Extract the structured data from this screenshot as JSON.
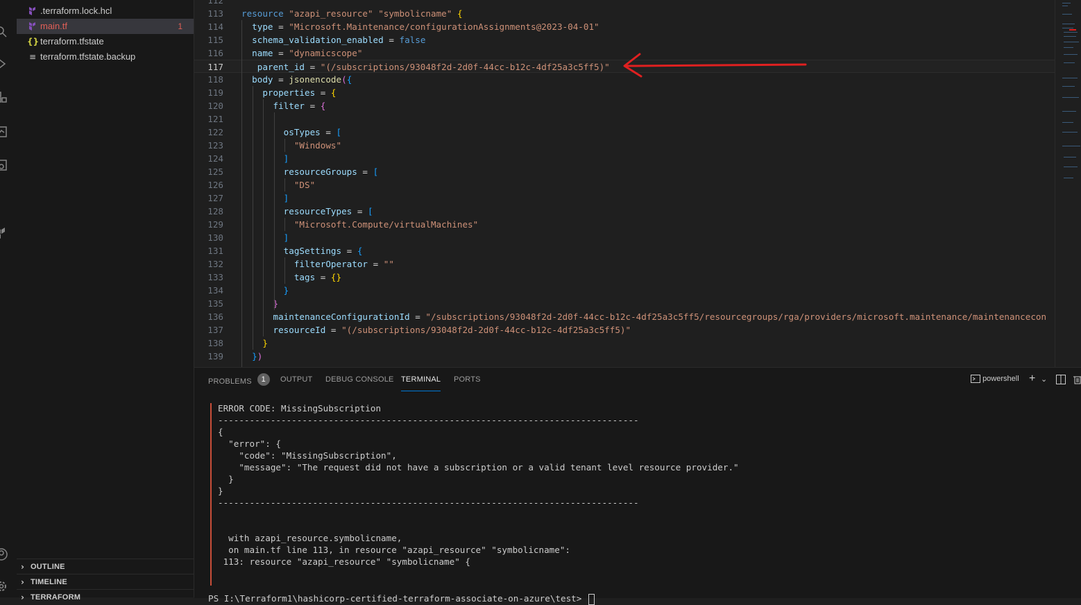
{
  "explorer": {
    "files": [
      {
        "name": ".terraform.lock.hcl",
        "icon": "terraform-icon",
        "active": false
      },
      {
        "name": "main.tf",
        "icon": "terraform-icon",
        "active": true,
        "problems": "1"
      },
      {
        "name": "terraform.tfstate",
        "icon": "json-braces-icon",
        "active": false
      },
      {
        "name": "terraform.tfstate.backup",
        "icon": "text-lines-icon",
        "active": false
      }
    ],
    "sections": [
      {
        "label": "OUTLINE",
        "collapsed": true
      },
      {
        "label": "TIMELINE",
        "collapsed": true
      },
      {
        "label": "TERRAFORM",
        "collapsed": true
      }
    ]
  },
  "editor": {
    "current_line": "117",
    "lines": [
      {
        "n": "112",
        "tokens": []
      },
      {
        "n": "113",
        "tokens": [
          [
            "kw",
            "resource"
          ],
          [
            "op",
            " "
          ],
          [
            "str",
            "\"azapi_resource\""
          ],
          [
            "op",
            " "
          ],
          [
            "str",
            "\"symbolicname\""
          ],
          [
            "op",
            " "
          ],
          [
            "br1",
            "{"
          ]
        ]
      },
      {
        "n": "114",
        "tokens": [
          [
            "op",
            "  "
          ],
          [
            "attr",
            "type"
          ],
          [
            "op",
            " = "
          ],
          [
            "str",
            "\"Microsoft.Maintenance/configurationAssignments@2023-04-01\""
          ]
        ]
      },
      {
        "n": "115",
        "tokens": [
          [
            "op",
            "  "
          ],
          [
            "attr",
            "schema_validation_enabled"
          ],
          [
            "op",
            " = "
          ],
          [
            "bool",
            "false"
          ]
        ]
      },
      {
        "n": "116",
        "tokens": [
          [
            "op",
            "  "
          ],
          [
            "attr",
            "name"
          ],
          [
            "op",
            " = "
          ],
          [
            "str",
            "\"dynamicscope\""
          ]
        ]
      },
      {
        "n": "117",
        "tokens": [
          [
            "op",
            "   "
          ],
          [
            "attr",
            "parent_id"
          ],
          [
            "op",
            " = "
          ],
          [
            "str",
            "\"(/subscriptions/93048f2d-2d0f-44cc-b12c-4df25a3c5ff5)\""
          ]
        ]
      },
      {
        "n": "118",
        "tokens": [
          [
            "op",
            "  "
          ],
          [
            "attr",
            "body"
          ],
          [
            "op",
            " = "
          ],
          [
            "fn",
            "jsonencode"
          ],
          [
            "br2",
            "("
          ],
          [
            "br3",
            "{"
          ]
        ]
      },
      {
        "n": "119",
        "tokens": [
          [
            "op",
            "    "
          ],
          [
            "attr",
            "properties"
          ],
          [
            "op",
            " = "
          ],
          [
            "br1",
            "{"
          ]
        ]
      },
      {
        "n": "120",
        "tokens": [
          [
            "op",
            "      "
          ],
          [
            "attr",
            "filter"
          ],
          [
            "op",
            " = "
          ],
          [
            "br2",
            "{"
          ]
        ]
      },
      {
        "n": "121",
        "tokens": []
      },
      {
        "n": "122",
        "tokens": [
          [
            "op",
            "        "
          ],
          [
            "attr",
            "osTypes"
          ],
          [
            "op",
            " = "
          ],
          [
            "br3",
            "["
          ]
        ]
      },
      {
        "n": "123",
        "tokens": [
          [
            "op",
            "          "
          ],
          [
            "str",
            "\"Windows\""
          ]
        ]
      },
      {
        "n": "124",
        "tokens": [
          [
            "op",
            "        "
          ],
          [
            "br3",
            "]"
          ]
        ]
      },
      {
        "n": "125",
        "tokens": [
          [
            "op",
            "        "
          ],
          [
            "attr",
            "resourceGroups"
          ],
          [
            "op",
            " = "
          ],
          [
            "br3",
            "["
          ]
        ]
      },
      {
        "n": "126",
        "tokens": [
          [
            "op",
            "          "
          ],
          [
            "str",
            "\"DS\""
          ]
        ]
      },
      {
        "n": "127",
        "tokens": [
          [
            "op",
            "        "
          ],
          [
            "br3",
            "]"
          ]
        ]
      },
      {
        "n": "128",
        "tokens": [
          [
            "op",
            "        "
          ],
          [
            "attr",
            "resourceTypes"
          ],
          [
            "op",
            " = "
          ],
          [
            "br3",
            "["
          ]
        ]
      },
      {
        "n": "129",
        "tokens": [
          [
            "op",
            "          "
          ],
          [
            "str",
            "\"Microsoft.Compute/virtualMachines\""
          ]
        ]
      },
      {
        "n": "130",
        "tokens": [
          [
            "op",
            "        "
          ],
          [
            "br3",
            "]"
          ]
        ]
      },
      {
        "n": "131",
        "tokens": [
          [
            "op",
            "        "
          ],
          [
            "attr",
            "tagSettings"
          ],
          [
            "op",
            " = "
          ],
          [
            "br3",
            "{"
          ]
        ]
      },
      {
        "n": "132",
        "tokens": [
          [
            "op",
            "          "
          ],
          [
            "attr",
            "filterOperator"
          ],
          [
            "op",
            " = "
          ],
          [
            "str",
            "\"\""
          ]
        ]
      },
      {
        "n": "133",
        "tokens": [
          [
            "op",
            "          "
          ],
          [
            "attr",
            "tags"
          ],
          [
            "op",
            " = "
          ],
          [
            "br1",
            "{}"
          ]
        ]
      },
      {
        "n": "134",
        "tokens": [
          [
            "op",
            "        "
          ],
          [
            "br3",
            "}"
          ]
        ]
      },
      {
        "n": "135",
        "tokens": [
          [
            "op",
            "      "
          ],
          [
            "br2",
            "}"
          ]
        ]
      },
      {
        "n": "136",
        "tokens": [
          [
            "op",
            "      "
          ],
          [
            "attr",
            "maintenanceConfigurationId"
          ],
          [
            "op",
            " = "
          ],
          [
            "str",
            "\"/subscriptions/93048f2d-2d0f-44cc-b12c-4df25a3c5ff5/resourcegroups/rga/providers/microsoft.maintenance/maintenancecon"
          ]
        ]
      },
      {
        "n": "137",
        "tokens": [
          [
            "op",
            "      "
          ],
          [
            "attr",
            "resourceId"
          ],
          [
            "op",
            " = "
          ],
          [
            "str",
            "\"(/subscriptions/93048f2d-2d0f-44cc-b12c-4df25a3c5ff5)\""
          ]
        ]
      },
      {
        "n": "138",
        "tokens": [
          [
            "op",
            "    "
          ],
          [
            "br1",
            "}"
          ]
        ]
      },
      {
        "n": "139",
        "tokens": [
          [
            "op",
            "  "
          ],
          [
            "br3",
            "}"
          ],
          [
            "br2",
            ")"
          ]
        ]
      }
    ]
  },
  "panel": {
    "tabs": [
      {
        "label": "PROBLEMS",
        "badge": "1",
        "active": false
      },
      {
        "label": "OUTPUT",
        "active": false
      },
      {
        "label": "DEBUG CONSOLE",
        "active": false
      },
      {
        "label": "TERMINAL",
        "active": true
      },
      {
        "label": "PORTS",
        "active": false
      }
    ],
    "terminal_shell": "powershell",
    "terminal_lines": [
      "ERROR CODE: MissingSubscription",
      "--------------------------------------------------------------------------------",
      "{",
      "  \"error\": {",
      "    \"code\": \"MissingSubscription\",",
      "    \"message\": \"The request did not have a subscription or a valid tenant level resource provider.\"",
      "  }",
      "}",
      "--------------------------------------------------------------------------------",
      "",
      "",
      "  with azapi_resource.symbolicname,",
      "  on main.tf line 113, in resource \"azapi_resource\" \"symbolicname\":",
      " 113: resource \"azapi_resource\" \"symbolicname\" {"
    ],
    "prompt": "PS I:\\Terraform1\\hashicorp-certified-terraform-associate-on-azure\\test> "
  },
  "colors": {
    "accent": "#0078d4",
    "error": "#c74e39",
    "annotation": "#e02020"
  }
}
